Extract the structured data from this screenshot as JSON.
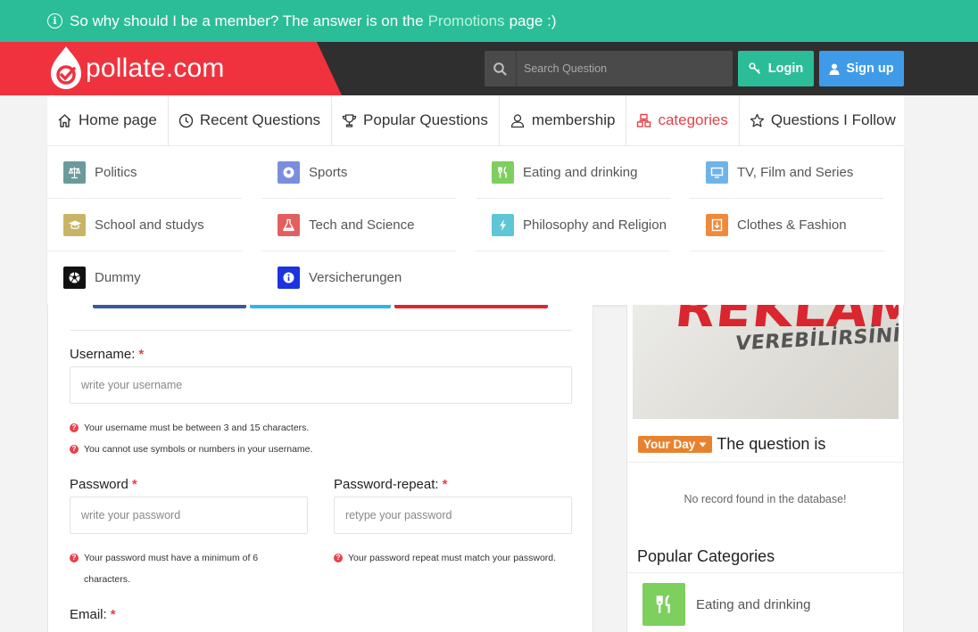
{
  "promo": {
    "text_before": "So why should I be a member? The answer is on the",
    "link": "Promotions",
    "text_after": "page :)"
  },
  "header": {
    "logo_text": "pollate.com",
    "search_placeholder": "Search Question",
    "login_label": "Login",
    "signup_label": "Sign up",
    "brand_color": "#f0323e",
    "accent_color": "#2bbd98"
  },
  "nav": {
    "items": [
      {
        "label": "Home page",
        "icon": "home-icon"
      },
      {
        "label": "Recent Questions",
        "icon": "clock-icon"
      },
      {
        "label": "Popular Questions",
        "icon": "trophy-icon"
      },
      {
        "label": "membership",
        "icon": "users-icon"
      },
      {
        "label": "categories",
        "icon": "grid-icon",
        "active": true
      },
      {
        "label": "Questions I Follow",
        "icon": "star-icon"
      }
    ]
  },
  "categories": [
    {
      "label": "Politics",
      "icon": "scale-icon",
      "color": "#6c9a9a"
    },
    {
      "label": "Sports",
      "icon": "soccer-ball-icon",
      "color": "#7a8ee0"
    },
    {
      "label": "Eating and drinking",
      "icon": "fork-knife-icon",
      "color": "#7dcf5e"
    },
    {
      "label": "TV, Film and Series",
      "icon": "tv-icon",
      "color": "#6fb4e8"
    },
    {
      "label": "School and studys",
      "icon": "graduation-cap-icon",
      "color": "#c9b466"
    },
    {
      "label": "Tech and Science",
      "icon": "flask-icon",
      "color": "#e35f5f"
    },
    {
      "label": "Philosophy and Religion",
      "icon": "bolt-icon",
      "color": "#5ec6d6"
    },
    {
      "label": "Clothes & Fashion",
      "icon": "download-box-icon",
      "color": "#f08a3a"
    },
    {
      "label": "Dummy",
      "icon": "soccer-ball-icon",
      "color": "#111111"
    },
    {
      "label": "Versicherungen",
      "icon": "info-icon",
      "color": "#1c33e0"
    }
  ],
  "form": {
    "username_label": "Username:",
    "username_placeholder": "write your username",
    "username_hint_1": "Your username must be between 3 and 15 characters.",
    "username_hint_2": "You cannot use symbols or numbers in your username.",
    "password_label": "Password",
    "password_placeholder": "write your password",
    "password_hint": "Your password must have a minimum of 6 characters.",
    "password_repeat_label": "Password-repeat:",
    "password_repeat_placeholder": "retype your password",
    "password_repeat_hint": "Your password repeat must match your password.",
    "email_label": "Email:",
    "required_mark": "*"
  },
  "sidebar": {
    "ad_text_1": "REKLAM",
    "ad_text_2": "VEREBİLİRSİNİZ!",
    "day_badge": "Your Day",
    "day_title": "The question is",
    "no_record": "No record found in the database!",
    "popular_title": "Popular Categories",
    "popular_items": [
      {
        "label": "Eating and drinking",
        "icon": "fork-knife-icon",
        "color": "#7dcf5e"
      }
    ]
  }
}
